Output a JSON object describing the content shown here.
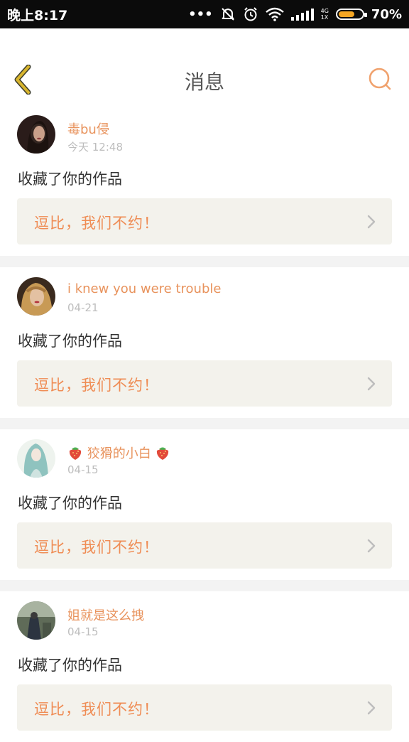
{
  "status_bar": {
    "time": "晚上8:17",
    "dots": "•••",
    "network": "4G\n1X",
    "battery": "70%",
    "battery_level": 0.7
  },
  "header": {
    "title": "消息",
    "back_icon": "chevron-left-icon",
    "search_icon": "search-icon"
  },
  "colors": {
    "accent": "#ef8c54",
    "name": "#e8935d",
    "card_bg": "#f3f2ec",
    "back_arrow": "#c9a227"
  },
  "messages": [
    {
      "name": "毒bu侵",
      "time": "今天 12:48",
      "action": "收藏了你的作品",
      "work": "逗比，我们不约！"
    },
    {
      "name": "i knew you were trouble",
      "time": "04-21",
      "action": "收藏了你的作品",
      "work": "逗比，我们不约！"
    },
    {
      "name": "狡猾的小白",
      "time": "04-15",
      "action": "收藏了你的作品",
      "work": "逗比，我们不约！"
    },
    {
      "name": "姐就是这么拽",
      "time": "04-15",
      "action": "收藏了你的作品",
      "work": "逗比，我们不约！"
    }
  ]
}
